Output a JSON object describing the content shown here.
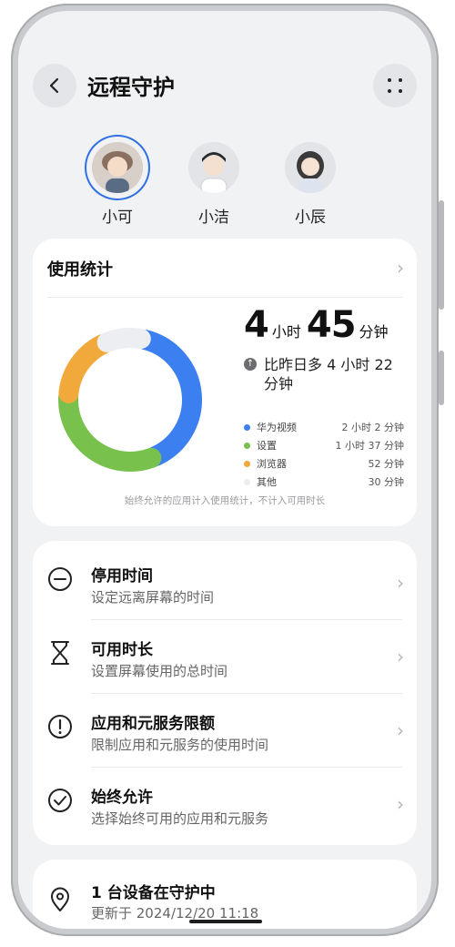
{
  "header": {
    "title": "远程守护"
  },
  "profiles": [
    {
      "name": "小可",
      "selected": true
    },
    {
      "name": "小洁",
      "selected": false
    },
    {
      "name": "小辰",
      "selected": false
    }
  ],
  "usage": {
    "title": "使用统计",
    "total_hours": "4",
    "hours_unit": "小时",
    "total_minutes": "45",
    "minutes_unit": "分钟",
    "compare_text": "比昨日多 4 小时 22 分钟",
    "legend": [
      {
        "label": "华为视频",
        "value": "2 小时 2 分钟",
        "color": "#3b7ff0"
      },
      {
        "label": "设置",
        "value": "1 小时 37 分钟",
        "color": "#77c14c"
      },
      {
        "label": "浏览器",
        "value": "52 分钟",
        "color": "#f2a93b"
      },
      {
        "label": "其他",
        "value": "30 分钟",
        "color": "#eceef1"
      }
    ],
    "note": "始终允许的应用计入使用统计，不计入可用时长"
  },
  "chart_data": {
    "type": "pie",
    "categories": [
      "华为视频",
      "设置",
      "浏览器",
      "其他"
    ],
    "values": [
      122,
      97,
      52,
      30
    ],
    "colors": [
      "#3b7ff0",
      "#77c14c",
      "#f2a93b",
      "#eceef1"
    ]
  },
  "menu": [
    {
      "title": "停用时间",
      "subtitle": "设定远离屏幕的时间",
      "icon": "minus-circle-icon"
    },
    {
      "title": "可用时长",
      "subtitle": "设置屏幕使用的总时间",
      "icon": "hourglass-icon"
    },
    {
      "title": "应用和元服务限额",
      "subtitle": "限制应用和元服务的使用时间",
      "icon": "exclamation-circle-icon"
    },
    {
      "title": "始终允许",
      "subtitle": "选择始终可用的应用和元服务",
      "icon": "check-circle-icon"
    }
  ],
  "device": {
    "title": "1 台设备在守护中",
    "subtitle": "更新于 2024/12/20 11:18",
    "icon": "location-pin-icon"
  }
}
